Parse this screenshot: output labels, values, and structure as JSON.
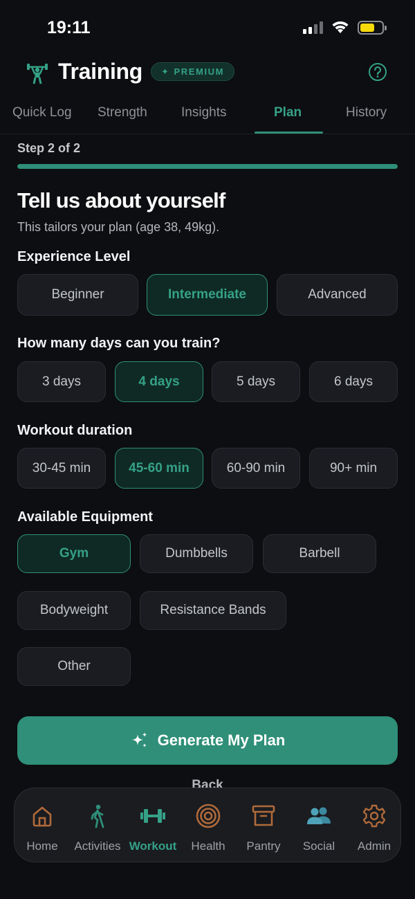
{
  "status_bar": {
    "time": "19:11"
  },
  "header": {
    "title": "Training",
    "badge": "PREMIUM"
  },
  "tabs": [
    {
      "label": "Quick Log",
      "active": false
    },
    {
      "label": "Strength",
      "active": false
    },
    {
      "label": "Insights",
      "active": false
    },
    {
      "label": "Plan",
      "active": true
    },
    {
      "label": "History",
      "active": false
    }
  ],
  "step": {
    "label": "Step 2 of 2",
    "progress": 1.0
  },
  "intro": {
    "title": "Tell us about yourself",
    "subtitle": "This tailors your plan (age 38, 49kg)."
  },
  "experience": {
    "label": "Experience Level",
    "options": [
      "Beginner",
      "Intermediate",
      "Advanced"
    ],
    "selected": "Intermediate"
  },
  "days": {
    "label": "How many days can you train?",
    "options": [
      "3 days",
      "4 days",
      "5 days",
      "6 days"
    ],
    "selected": "4 days"
  },
  "duration": {
    "label": "Workout duration",
    "options": [
      "30-45 min",
      "45-60 min",
      "60-90 min",
      "90+ min"
    ],
    "selected": "45-60 min"
  },
  "equipment": {
    "label": "Available Equipment",
    "options": [
      "Gym",
      "Dumbbells",
      "Barbell",
      "Bodyweight",
      "Resistance Bands",
      "Other"
    ],
    "selected": [
      "Gym"
    ]
  },
  "actions": {
    "generate": "Generate My Plan",
    "back": "Back"
  },
  "bottom_nav": [
    {
      "label": "Home",
      "icon": "home-icon"
    },
    {
      "label": "Activities",
      "icon": "walking-icon"
    },
    {
      "label": "Workout",
      "icon": "dumbbell-icon",
      "active": true
    },
    {
      "label": "Health",
      "icon": "target-icon"
    },
    {
      "label": "Pantry",
      "icon": "archive-box-icon"
    },
    {
      "label": "Social",
      "icon": "people-icon"
    },
    {
      "label": "Admin",
      "icon": "gear-icon"
    }
  ],
  "colors": {
    "accent": "#2f8f78",
    "accent_text": "#35a187",
    "background": "#0d0e11",
    "pantry_icon": "#b06a3a"
  }
}
